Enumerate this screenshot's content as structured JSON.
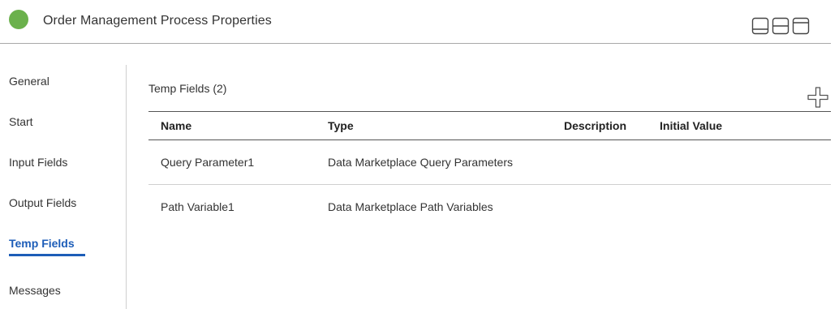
{
  "header": {
    "title": "Order Management Process Properties",
    "status_color": "#6bb14c",
    "layout_icons": [
      "panel-bottom-icon",
      "panel-split-horizontal-icon",
      "panel-top-icon"
    ]
  },
  "sidebar": {
    "items": [
      {
        "label": "General",
        "active": false
      },
      {
        "label": "Start",
        "active": false
      },
      {
        "label": "Input Fields",
        "active": false
      },
      {
        "label": "Output Fields",
        "active": false
      },
      {
        "label": "Temp Fields",
        "active": true
      },
      {
        "label": "Messages",
        "active": false
      }
    ],
    "active_color": "#1d5db8"
  },
  "main": {
    "section_title": "Temp Fields (2)",
    "add_icon": "plus-icon",
    "table": {
      "columns": [
        "Name",
        "Type",
        "Description",
        "Initial Value"
      ],
      "rows": [
        {
          "name": "Query Parameter1",
          "type": "Data Marketplace Query Parameters",
          "description": "",
          "initial_value": ""
        },
        {
          "name": "Path Variable1",
          "type": "Data Marketplace Path Variables",
          "description": "",
          "initial_value": ""
        }
      ]
    }
  }
}
